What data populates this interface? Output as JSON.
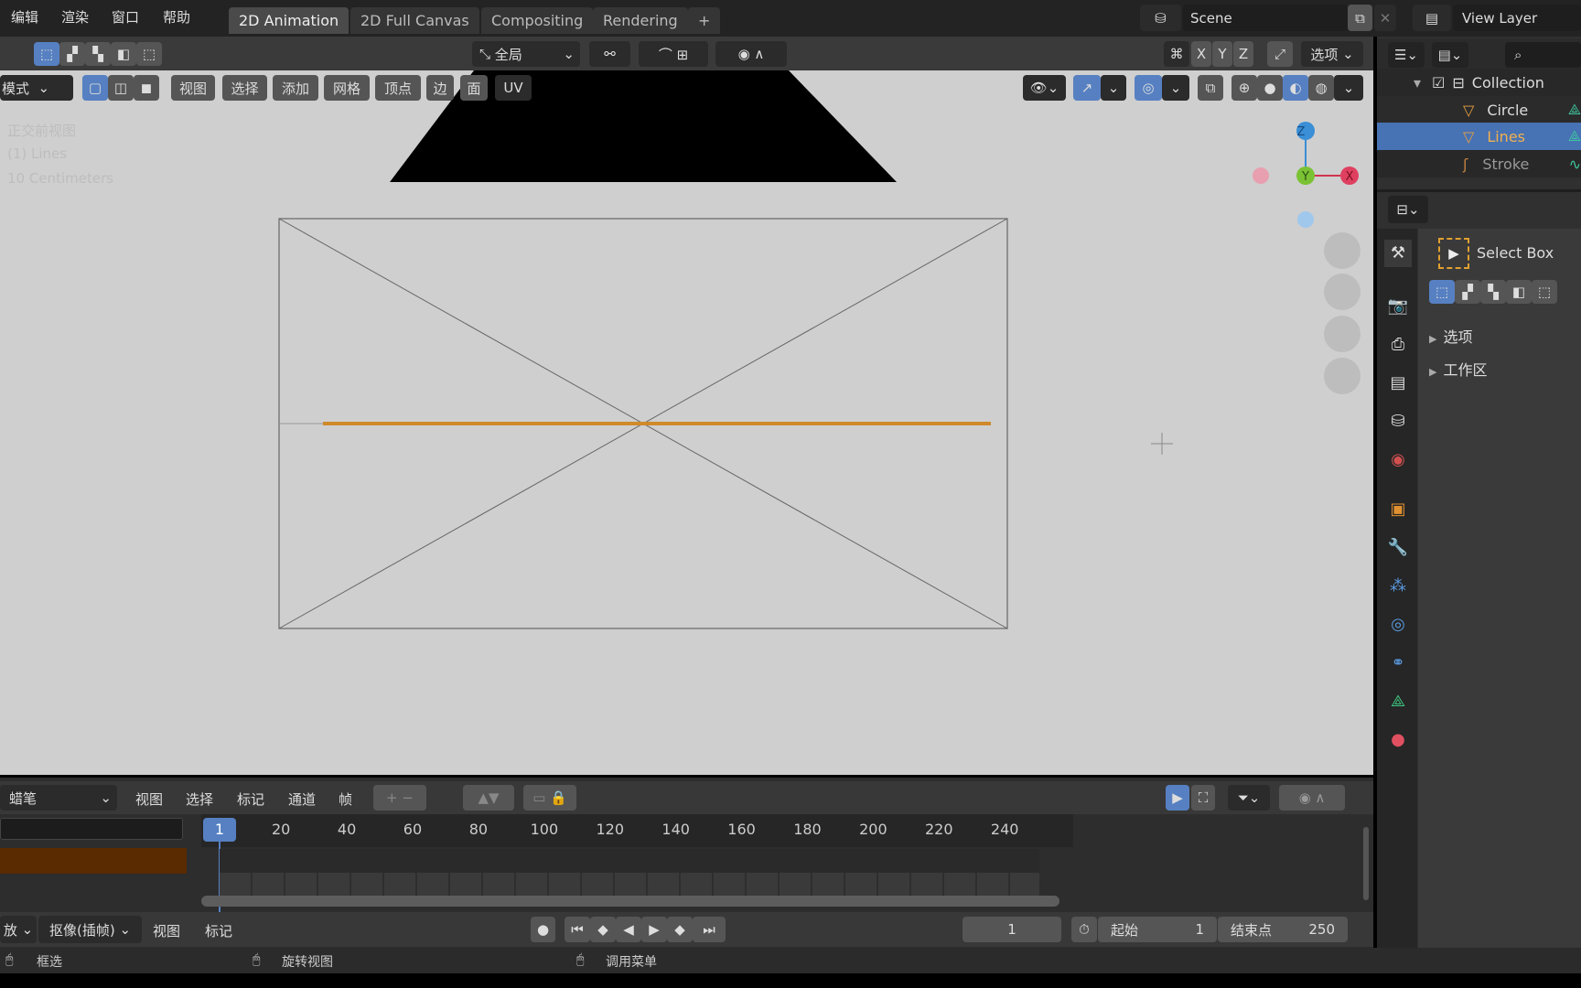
{
  "menu": [
    "编辑",
    "渲染",
    "窗口",
    "帮助"
  ],
  "workspaces": [
    "2D Animation",
    "2D Full Canvas",
    "Compositing",
    "Rendering"
  ],
  "add_workspace": "+",
  "scene": "Scene",
  "view_layer": "View Layer",
  "tool_header": {
    "orientation": "全局",
    "axes": [
      "X",
      "Y",
      "Z"
    ],
    "options": "选项"
  },
  "viewport_header": {
    "mode": "模式",
    "menus": [
      "视图",
      "选择",
      "添加",
      "网格",
      "顶点",
      "边",
      "面",
      "UV"
    ]
  },
  "overlay_text": [
    "正交前视图",
    "(1) Lines",
    "10 Centimeters"
  ],
  "gizmo": {
    "z": "Z",
    "y": "Y",
    "x": "X"
  },
  "outliner": {
    "items": [
      {
        "label": "Collection",
        "selected": false
      },
      {
        "label": "Circle",
        "selected": false
      },
      {
        "label": "Lines",
        "selected": true
      },
      {
        "label": "Stroke",
        "selected": false
      }
    ]
  },
  "properties": {
    "tool": "Select Box",
    "sections": [
      "选项",
      "工作区"
    ]
  },
  "timeline": {
    "mode": "蜡笔",
    "menus": [
      "视图",
      "选择",
      "标记",
      "通道",
      "帧"
    ],
    "current_frame": "1",
    "ticks": [
      "20",
      "40",
      "60",
      "80",
      "100",
      "120",
      "140",
      "160",
      "180",
      "200",
      "220",
      "240"
    ]
  },
  "playback": {
    "play_menu": "放",
    "keying": "抠像(插帧)",
    "view": "视图",
    "marker": "标记",
    "frame": "1",
    "start_label": "起始",
    "start": "1",
    "end_label": "结束点",
    "end": "250"
  },
  "status": [
    "框选",
    "旋转视图",
    "调用菜单"
  ],
  "colors": {
    "accent": "#5680c2",
    "selected_line": "#d08a2a",
    "channel": "#5a2a00"
  }
}
